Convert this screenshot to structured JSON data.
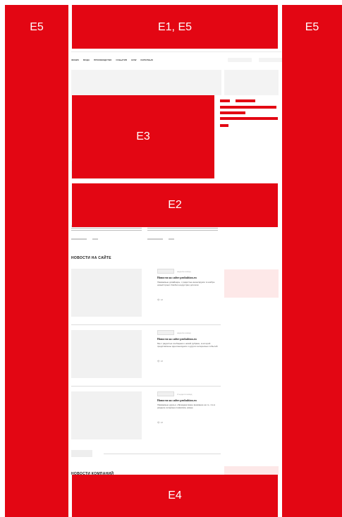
{
  "annotations": {
    "left": "E5",
    "top": "E1, E5",
    "right": "E5",
    "hero": "E3",
    "banner": "E2",
    "bottom": "E4"
  },
  "nav": {
    "items": [
      "ФИНИЗ",
      "МОДА",
      "ПРОИЗВОДСТВО",
      "СОБЫТИЯ",
      "HOW",
      "ИНТЕРВЬЮ"
    ]
  },
  "sections": {
    "site_news": "НОВОСТИ НА САЙТЕ",
    "company_news": "НОВОСТИ КОМПАНИЙ"
  },
  "news": [
    {
      "date": "неделю назад",
      "title": "Новости на сайте profashion.ru",
      "excerpt": "Уважаемые дизайнеры, с радостью анонсируем: в ноябре новый проект Fashion-индустрии для всех",
      "views": "18"
    },
    {
      "date": "неделю назад",
      "title": "Новости на сайте profashion.ru",
      "excerpt": "Мы с радостью сообщаем о новой рубрике, в которой представлены идеи выходного и других интересных событий",
      "views": "18"
    },
    {
      "date": "2 недели назад",
      "title": "Новости на сайте profashion.ru",
      "excerpt": "Уважаемые друзья, обращаем ваше внимание на то, что в разделе интервью появились новые",
      "views": "18"
    }
  ],
  "colors": {
    "annotation_red": "#e30613",
    "ad_pink": "#fde8e8",
    "placeholder_gray": "#f3f3f3"
  }
}
